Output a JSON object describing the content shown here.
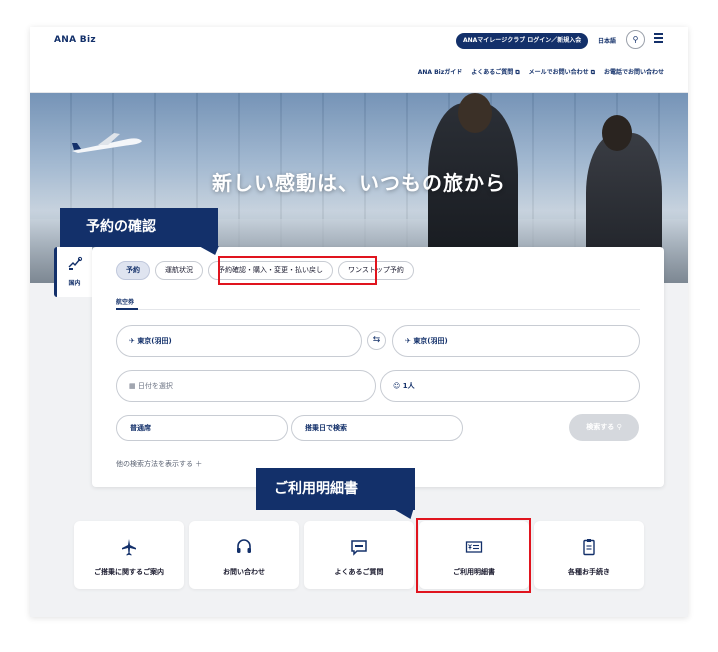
{
  "header": {
    "logo": "ANA Biz",
    "login_label": "ANAマイレージクラブ ログイン／新規入会",
    "language": "日本語",
    "util_links": [
      "ANA Bizガイド",
      "よくあるご質問 ⧉",
      "メールでお問い合わせ ⧉",
      "お電話でお問い合わせ"
    ]
  },
  "hero": {
    "title": "新しい感動は、いつもの旅から"
  },
  "booking": {
    "side_tab_label": "国内",
    "tabs": [
      "予約",
      "運航状況",
      "予約確認・購入・変更・払い戻し",
      "ワンストップ予約"
    ],
    "subtab": "航空券",
    "from": "東京(羽田)",
    "to": "東京(羽田)",
    "date_placeholder": "日付を選択",
    "passengers": "1人",
    "seat_class": "普通席",
    "search_by_seat": "搭乗日で検索",
    "search_button": "検索する",
    "more_link": "他の検索方法を表示する ＋"
  },
  "quick_links": [
    "ご搭乗に関するご案内",
    "お問い合わせ",
    "よくあるご質問",
    "ご利用明細書",
    "各種お手続き"
  ],
  "annotations": {
    "callout_top": "予約の確認",
    "callout_bottom": "ご利用明細書"
  },
  "colors": {
    "brand_navy": "#13306a",
    "highlight_red": "#e0141e"
  }
}
